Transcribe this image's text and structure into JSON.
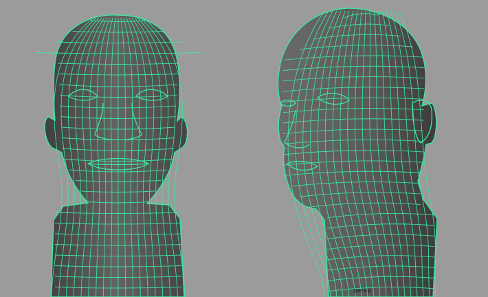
{
  "viewport": {
    "camera": "persp",
    "background_color": "#9b9b9b"
  },
  "mesh": {
    "surface_color": "#5d5d5d",
    "shadow_color": "#3e3e3e",
    "wire_color": "#3ee8a0"
  },
  "views": [
    {
      "name": "front-view"
    },
    {
      "name": "three-quarter-view"
    }
  ]
}
